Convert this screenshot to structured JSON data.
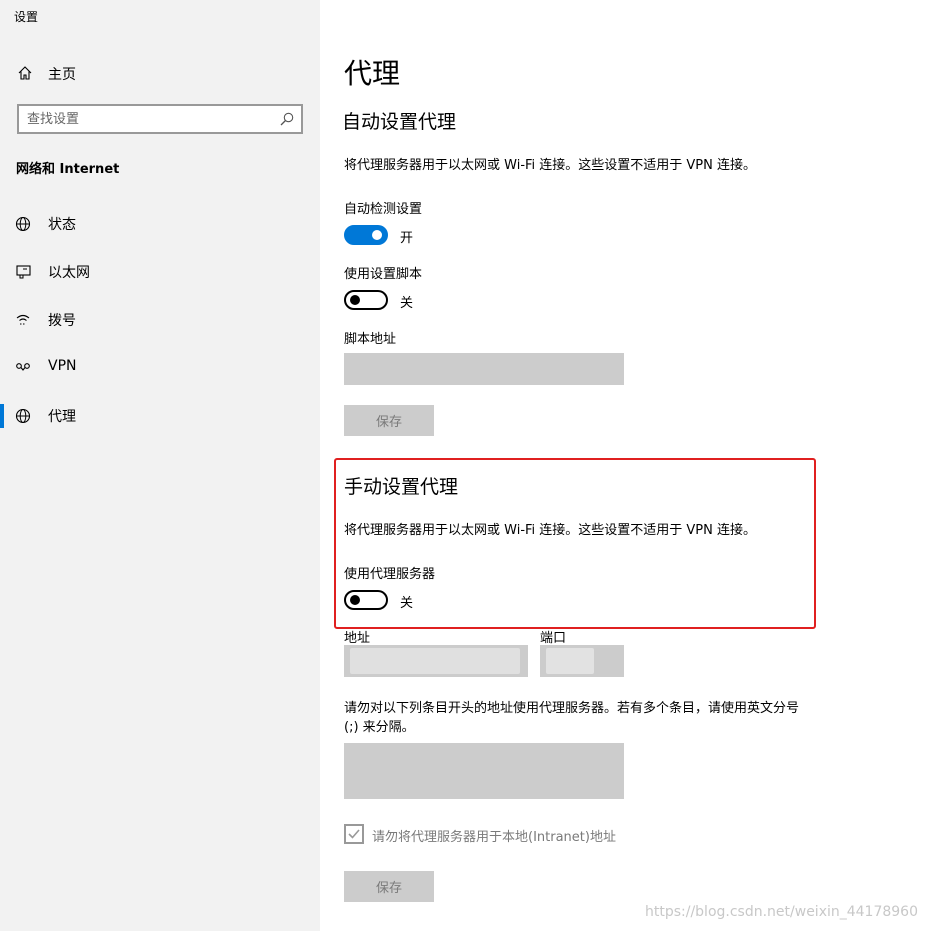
{
  "window": {
    "title": "设置"
  },
  "sidebar": {
    "home_label": "主页",
    "search_placeholder": "查找设置",
    "section_title": "网络和 Internet",
    "items": [
      {
        "label": "状态",
        "icon": "globe-status-icon"
      },
      {
        "label": "以太网",
        "icon": "ethernet-icon"
      },
      {
        "label": "拨号",
        "icon": "dialup-icon"
      },
      {
        "label": "VPN",
        "icon": "vpn-icon"
      },
      {
        "label": "代理",
        "icon": "globe-icon",
        "active": true
      }
    ]
  },
  "main": {
    "page_title": "代理",
    "auto": {
      "heading": "自动设置代理",
      "description": "将代理服务器用于以太网或 Wi-Fi 连接。这些设置不适用于 VPN 连接。",
      "detect_label": "自动检测设置",
      "detect_state": "开",
      "script_label": "使用设置脚本",
      "script_state": "关",
      "script_address_label": "脚本地址",
      "save_label": "保存"
    },
    "manual": {
      "heading": "手动设置代理",
      "description": "将代理服务器用于以太网或 Wi-Fi 连接。这些设置不适用于 VPN 连接。",
      "use_proxy_label": "使用代理服务器",
      "use_proxy_state": "关",
      "address_label": "地址",
      "port_label": "端口",
      "exceptions_description": "请勿对以下列条目开头的地址使用代理服务器。若有多个条目，请使用英文分号 (;) 来分隔。",
      "local_checkbox_label": "请勿将代理服务器用于本地(Intranet)地址",
      "local_checkbox_checked": true,
      "save_label": "保存"
    }
  },
  "watermark": "https://blog.csdn.net/weixin_44178960",
  "colors": {
    "accent": "#0078d7",
    "highlight_border": "#e02020",
    "field_bg": "#cccccc"
  }
}
